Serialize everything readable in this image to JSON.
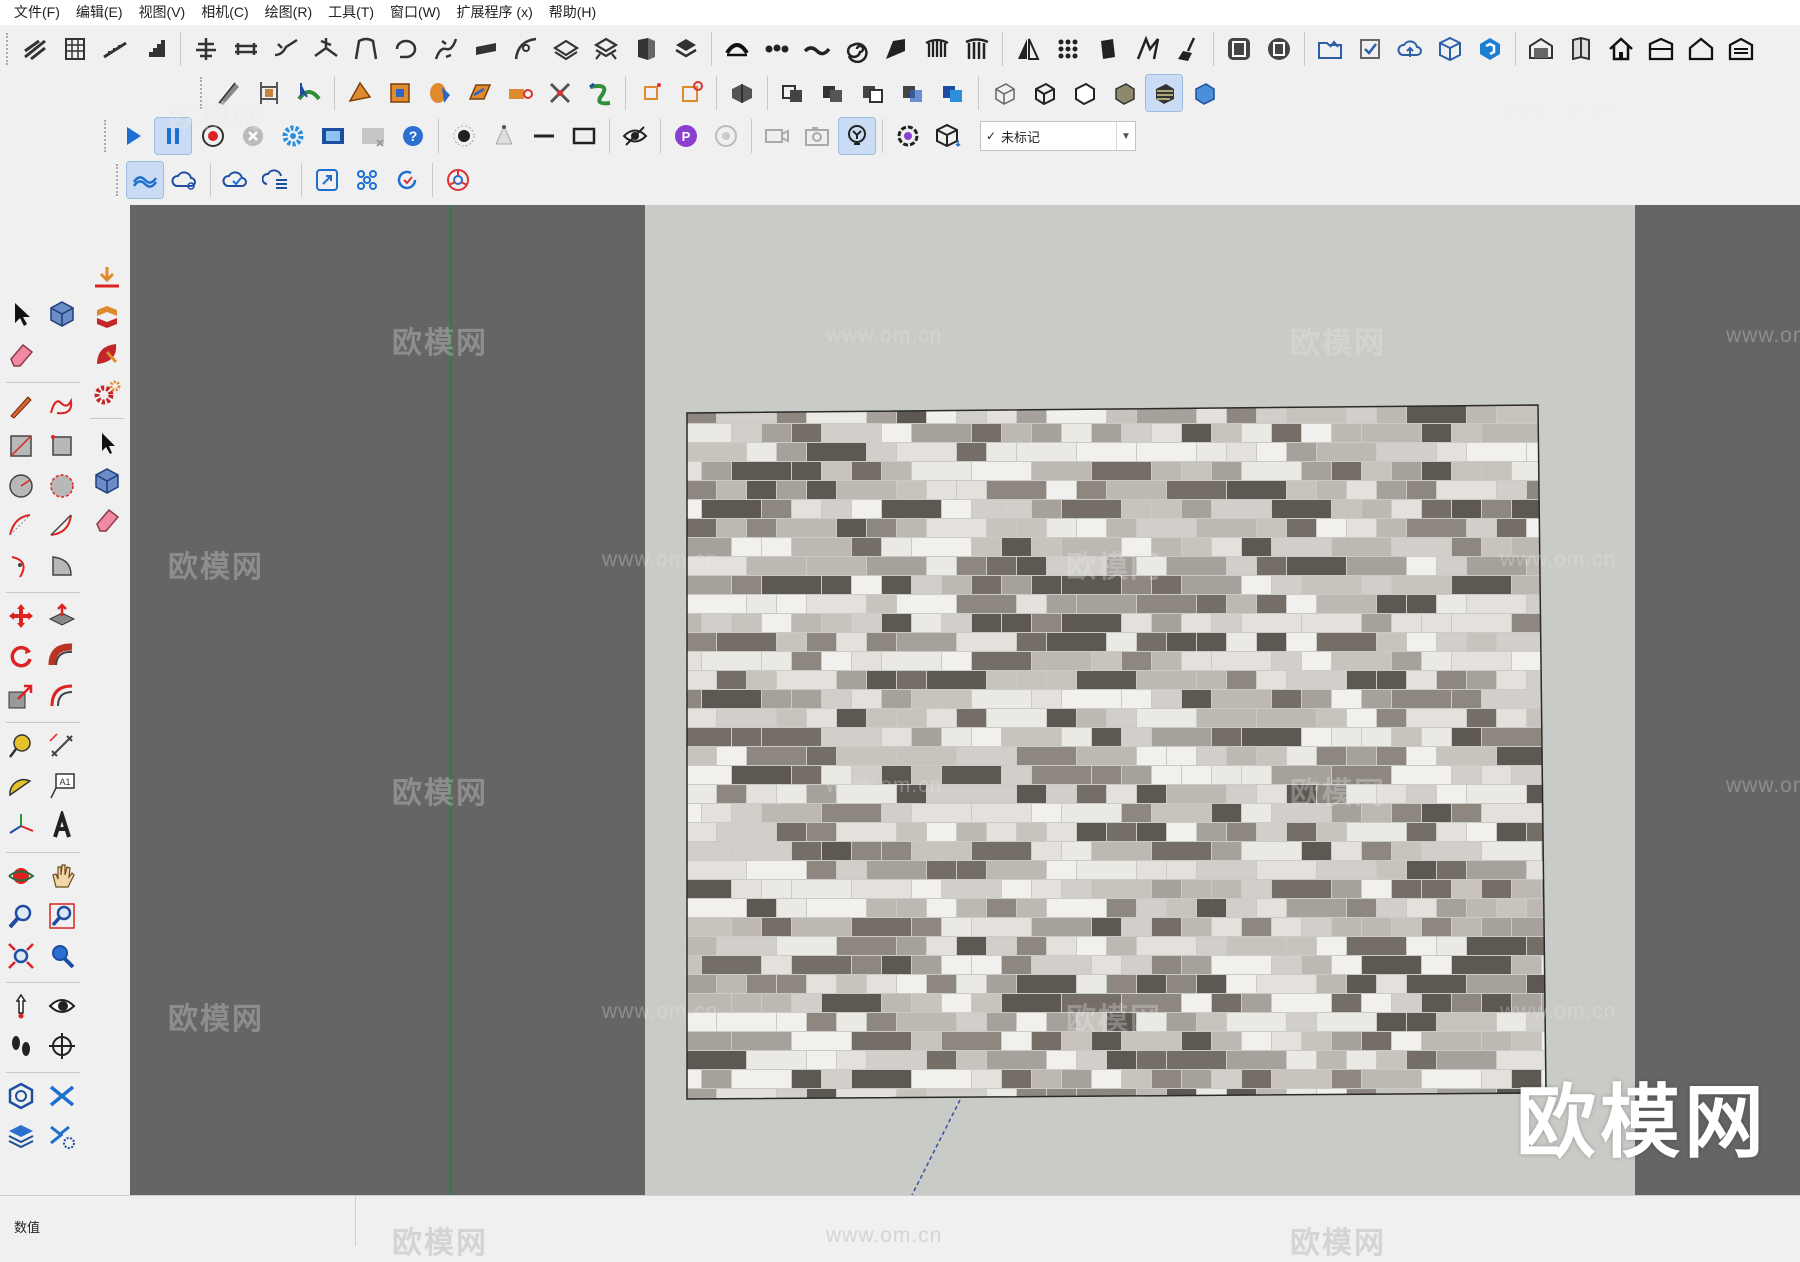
{
  "menubar": {
    "items": [
      {
        "label": "文件(F)"
      },
      {
        "label": "编辑(E)"
      },
      {
        "label": "视图(V)"
      },
      {
        "label": "相机(C)"
      },
      {
        "label": "绘图(R)"
      },
      {
        "label": "工具(T)"
      },
      {
        "label": "窗口(W)"
      },
      {
        "label": "扩展程序 (x)"
      },
      {
        "label": "帮助(H)"
      }
    ]
  },
  "toolbar": {
    "tag_selector": {
      "checked": true,
      "value": "未标记"
    }
  },
  "viewport": {
    "watermarks": {
      "brand_cn": "欧模网",
      "site_url": "www.om.cn"
    },
    "material": "grey/white cowhide patchwork rug texture"
  },
  "statusbar": {
    "measurements_label": "数值",
    "measurements_value": ""
  },
  "colors": {
    "viewport_bg": "#656565",
    "page_area": "#c9cbc6",
    "green_axis": "#2f7d38",
    "menu_bg": "#ffffff",
    "chrome_bg": "#f0f0f0"
  }
}
